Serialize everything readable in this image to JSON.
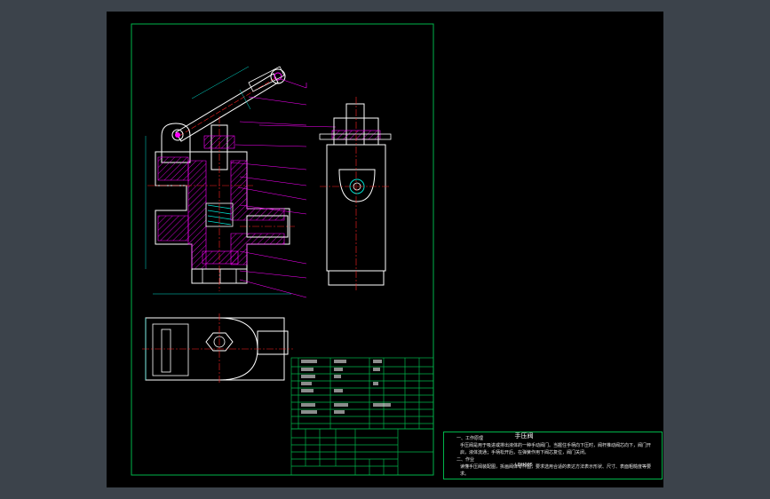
{
  "drawing": {
    "title_block_name": "手压阀",
    "title_block_code": "LDH005"
  },
  "tech_requirements": {
    "heading_1": "一、工作原理",
    "body_1": "手压阀是用于吸进或排出液体的一种手动阀门。当握住手柄向下压时，阀杆推动阀芯向下，阀门开启，液体流通；手柄松开后，在弹簧作用下阀芯复位，阀门关闭。",
    "heading_2": "二、作业",
    "body_2": "读懂手压阀装配图，拆画阀体零件图，要求选用合适的表达方法表示形状、尺寸、表面粗糙度等要求。"
  },
  "colors": {
    "frame": "#00b44a",
    "outline": "#ffffff",
    "section": "#ff00ff",
    "center": "#ff2020",
    "dimension": "#00e0d0",
    "leader": "#ff00ff",
    "background": "#000000"
  }
}
